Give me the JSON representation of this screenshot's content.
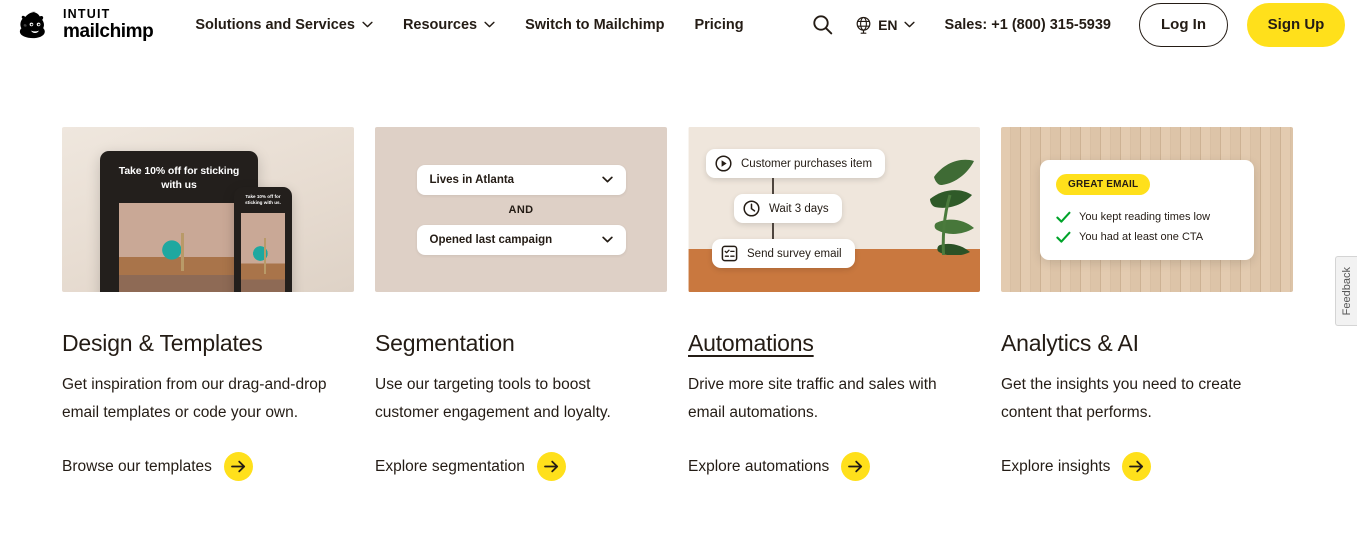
{
  "header": {
    "logo": {
      "intuit": "INTUIT",
      "mailchimp": "mailchimp",
      "icon": "mailchimp-freddie-icon"
    },
    "nav": [
      {
        "label": "Solutions and Services",
        "has_dropdown": true
      },
      {
        "label": "Resources",
        "has_dropdown": true
      },
      {
        "label": "Switch to Mailchimp",
        "has_dropdown": false
      },
      {
        "label": "Pricing",
        "has_dropdown": false
      }
    ],
    "search_icon": "search-icon",
    "language": {
      "icon": "globe-icon",
      "label": "EN"
    },
    "sales": "Sales: +1 (800) 315-5939",
    "login_label": "Log In",
    "signup_label": "Sign Up"
  },
  "cards": [
    {
      "title": "Design & Templates",
      "underlined": false,
      "desc": "Get inspiration from our drag-and-drop email templates or code your own.",
      "cta": "Browse our templates",
      "media": {
        "type": "device-mockup",
        "headline": "Take 10% off for sticking with us",
        "phone_headline": "Take 10% off for sticking with us."
      }
    },
    {
      "title": "Segmentation",
      "underlined": false,
      "desc": "Use our targeting tools to boost customer engagement and loyalty.",
      "cta": "Explore segmentation",
      "media": {
        "type": "segment-builder",
        "rule_one": "Lives in Atlanta",
        "operator": "AND",
        "rule_two": "Opened last campaign"
      }
    },
    {
      "title": "Automations",
      "underlined": true,
      "desc": "Drive more site traffic and sales with email automations.",
      "cta": "Explore automations",
      "media": {
        "type": "automation-flow",
        "steps": [
          {
            "icon": "play-circle-icon",
            "label": "Customer purchases item"
          },
          {
            "icon": "clock-icon",
            "label": "Wait 3 days"
          },
          {
            "icon": "checklist-icon",
            "label": "Send survey email"
          }
        ]
      }
    },
    {
      "title": "Analytics & AI",
      "underlined": false,
      "desc": "Get the insights you need to create content that performs.",
      "cta": "Explore insights",
      "media": {
        "type": "insight-card",
        "badge": "GREAT EMAIL",
        "items": [
          "You kept reading times low",
          "You had at least one CTA"
        ]
      }
    }
  ],
  "feedback": {
    "label": "Feedback"
  },
  "colors": {
    "brand_yellow": "#FFE01B",
    "text": "#241c15",
    "check_green": "#00A32A"
  }
}
